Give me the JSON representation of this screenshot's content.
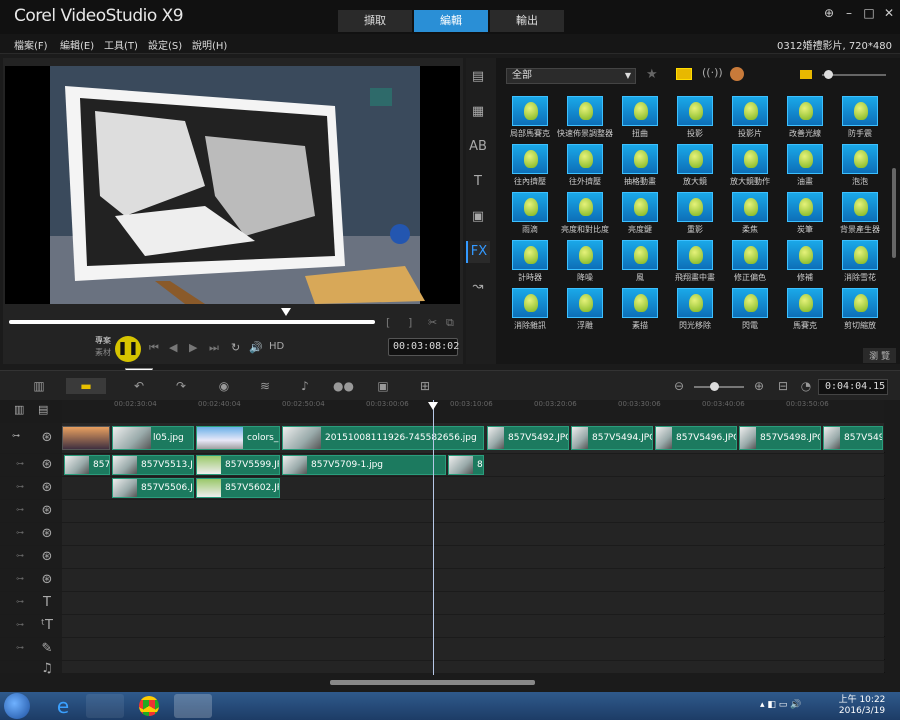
{
  "app": {
    "title": "Corel VideoStudio X9",
    "tabs": [
      "擷取",
      "編輯",
      "輸出"
    ],
    "active_tab": "編輯"
  },
  "menu": [
    "檔案(F)",
    "編輯(E)",
    "工具(T)",
    "設定(S)",
    "說明(H)"
  ],
  "project_info": "0312婚禮影片, 720*480",
  "preview": {
    "timecode": "00:03:08:02",
    "tooltip": "暫停",
    "mode_labels": [
      "專案",
      "素材"
    ],
    "hd_label": "HD"
  },
  "library": {
    "filter": "全部",
    "browse": "瀏 覽",
    "sidebar_icons": [
      "media-icon",
      "instant-project-icon",
      "transition-icon",
      "title-icon",
      "graphic-icon",
      "fx-icon",
      "path-icon"
    ],
    "effects": [
      "局部馬賽克",
      "快速佈景調整器",
      "扭曲",
      "投影",
      "投影片",
      "改善光線",
      "防手震",
      "往內擠壓",
      "往外擠壓",
      "抽格動畫",
      "放大鏡",
      "放大鏡動作",
      "油畫",
      "泡泡",
      "雨滴",
      "亮度和對比度",
      "亮度鍵",
      "重影",
      "柔焦",
      "炭筆",
      "背景產生器",
      "計時器",
      "降噪",
      "風",
      "飛翔畫中畫",
      "修正偏色",
      "修補",
      "消除雪花",
      "消除雜訊",
      "浮雕",
      "素描",
      "閃光移除",
      "閃電",
      "馬賽克",
      "剪切縮放"
    ]
  },
  "timeline": {
    "timecode": "0:04:04.15",
    "ruler": [
      "00:02:30:04",
      "00:02:40:04",
      "00:02:50:04",
      "00:03:00:06",
      "00:03:10:06",
      "00:03:20:06",
      "00:03:30:06",
      "00:03:40:06",
      "00:03:50:06"
    ],
    "video_clips": [
      "l05.jpg",
      "colors_",
      "20151008111926-745582656.jpg",
      "857V5492.JPG",
      "857V5494.JPG",
      "857V5496.JPG",
      "857V5498.JPG",
      "857V549"
    ],
    "overlay1_clips": [
      "857",
      "857V5513.JPG",
      "857V5599.JPG",
      "857V5709-1.jpg",
      "8"
    ],
    "overlay2_clips": [
      "857V5506.JPG",
      "857V5602.JPG"
    ]
  },
  "taskbar": {
    "time": "上午 10:22",
    "date": "2016/3/19"
  }
}
